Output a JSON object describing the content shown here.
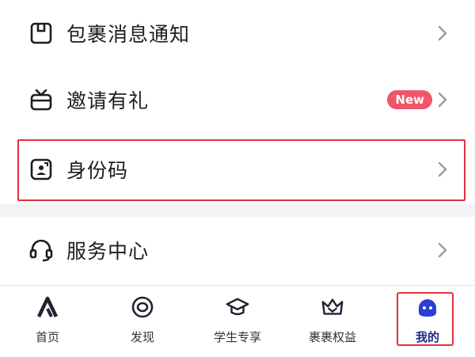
{
  "menu": {
    "items": [
      {
        "label": "包裹消息通知",
        "icon": "package-notice-icon"
      },
      {
        "label": "邀请有礼",
        "icon": "gift-tv-icon",
        "badge": "New"
      },
      {
        "label": "身份码",
        "icon": "id-code-icon"
      },
      {
        "label": "服务中心",
        "icon": "headset-icon"
      }
    ]
  },
  "tabbar": {
    "tabs": [
      {
        "label": "首页",
        "icon": "home-a-icon"
      },
      {
        "label": "发现",
        "icon": "discover-eye-icon"
      },
      {
        "label": "学生专享",
        "icon": "graduation-cap-icon"
      },
      {
        "label": "裹裹权益",
        "icon": "crown-benefit-icon"
      },
      {
        "label": "我的",
        "icon": "profile-ghost-icon",
        "active": true
      }
    ]
  },
  "colors": {
    "accent": "#2b3dd6",
    "badge": "#f0566a",
    "highlight": "#e0323c",
    "divider": "#f3f4f7"
  }
}
